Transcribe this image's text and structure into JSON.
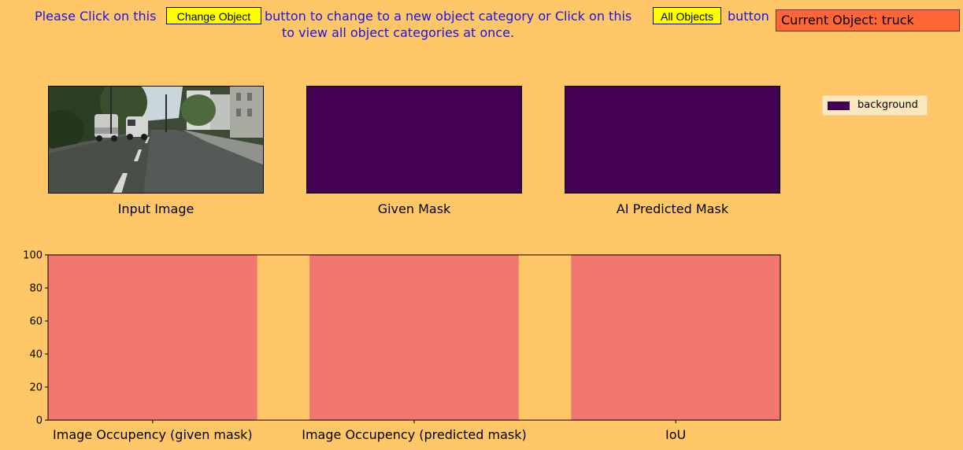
{
  "instruction": {
    "part1": "Please Click on this",
    "change_button": "Change Object",
    "part2": "button to change to a new object category or Click on this",
    "all_button": "All Objects",
    "part3": "button",
    "line2": "to view all object categories at once."
  },
  "current_object": "Current Object: truck",
  "panels": {
    "input_caption": "Input Image",
    "given_caption": "Given Mask",
    "predicted_caption": "AI Predicted Mask"
  },
  "legend": {
    "label": "background",
    "color": "#440154"
  },
  "colors": {
    "background": "#FFC767",
    "bar": "#F2776E",
    "mask": "#440154",
    "current_object_bg": "#FF6535",
    "button_bg": "#FFFF00",
    "instruction_text": "#1A14E6"
  },
  "chart_data": {
    "type": "bar",
    "categories": [
      "Image Occupency (given mask)",
      "Image Occupency (predicted mask)",
      "IoU"
    ],
    "values": [
      100,
      100,
      100
    ],
    "ylim": [
      0,
      100
    ],
    "yticks": [
      0,
      20,
      40,
      60,
      80,
      100
    ],
    "xlabel": "",
    "ylabel": "",
    "title": ""
  }
}
